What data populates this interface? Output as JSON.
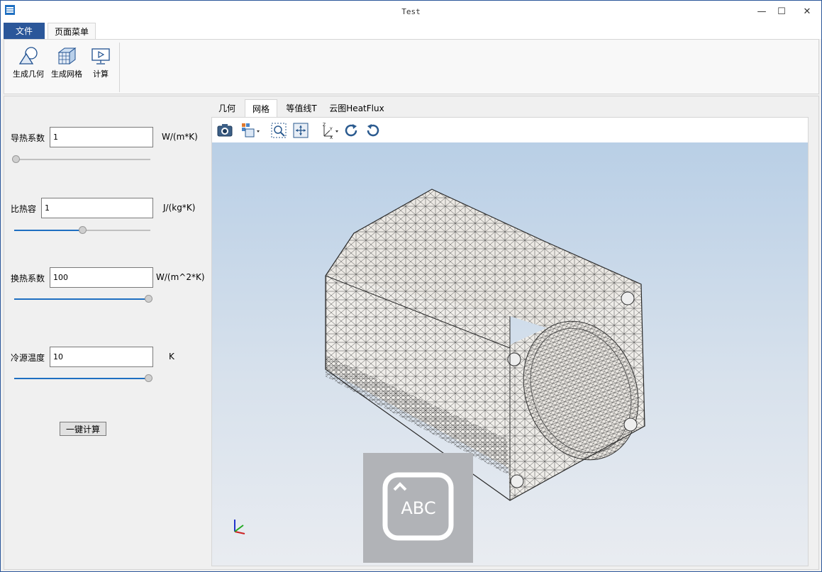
{
  "window": {
    "title": "Test",
    "minimize": "—",
    "maximize": "☐",
    "close": "✕"
  },
  "ribbon": {
    "tabs": [
      "文件",
      "页面菜单"
    ],
    "buttons": [
      "生成几何",
      "生成网格",
      "计算"
    ]
  },
  "params": [
    {
      "label": "导热系数",
      "value": "1",
      "unit": "W/(m*K)",
      "slider": 0.0
    },
    {
      "label": "比热容",
      "value": "1",
      "unit": "J/(kg*K)",
      "slider": 0.5
    },
    {
      "label": "换热系数",
      "value": "100",
      "unit": "W/(m^2*K)",
      "slider": 1.0
    },
    {
      "label": "冷源温度",
      "value": "10",
      "unit": "K",
      "slider": 1.0
    }
  ],
  "calc_button": "一键计算",
  "view_tabs": [
    "几何",
    "网格",
    "等值线T",
    "云图HeatFlux"
  ],
  "active_view_tab": 1,
  "toolbar_icons": [
    "camera-icon",
    "display-mode-icon",
    "zoom-box-icon",
    "fit-all-icon",
    "axes-orientation-icon",
    "rotate-cw-icon",
    "rotate-ccw-icon"
  ],
  "ime_overlay": "ABC",
  "colors": {
    "accent": "#2b579a",
    "slider_fill": "#1e6fc1",
    "viewport_top": "#b9cfe6",
    "viewport_bottom": "#e9ecf1"
  }
}
